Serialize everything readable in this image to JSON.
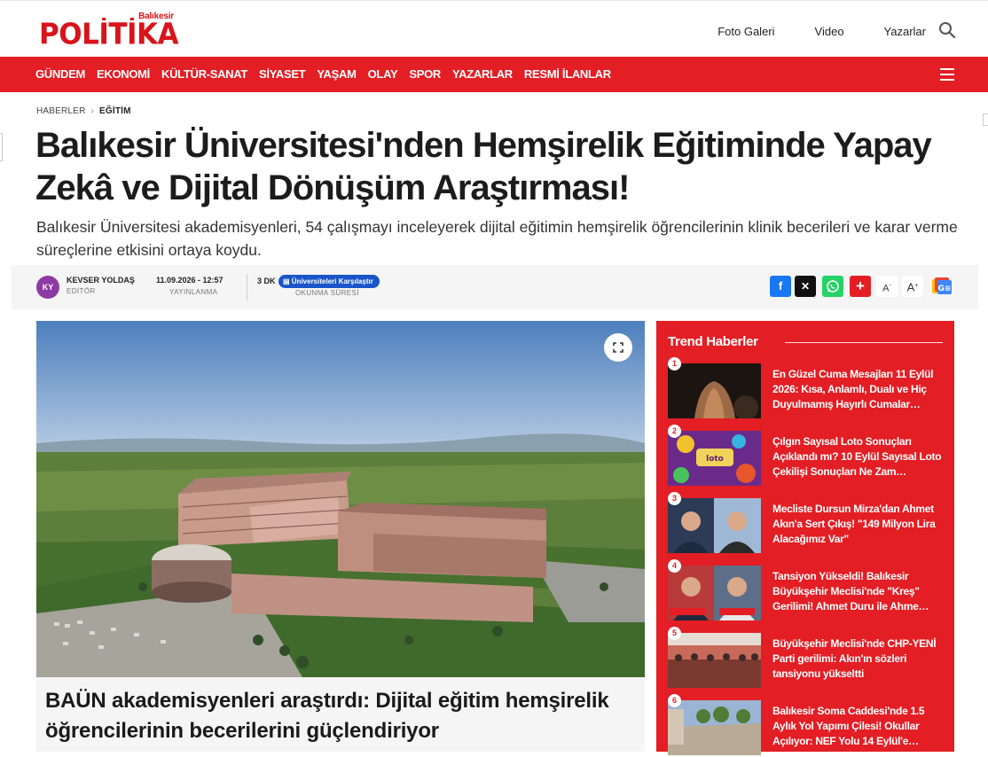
{
  "site": {
    "brand_small": "Balıkesir",
    "brand_big": "POLİTİKA",
    "brand_color": "#d9141b"
  },
  "top_links": [
    "Foto Galeri",
    "Video",
    "Yazarlar"
  ],
  "nav": {
    "items": [
      "GÜNDEM",
      "EKONOMİ",
      "KÜLTÜR-SANAT",
      "SİYASET",
      "YAŞAM",
      "OLAY",
      "SPOR",
      "YAZARLAR",
      "RESMİ İLANLAR"
    ],
    "color": "#e31e24"
  },
  "breadcrumb": {
    "home": "HABERLER",
    "current": "EĞİTİM"
  },
  "article": {
    "headline": "Balıkesir Üniversitesi'nden Hemşirelik Eğitiminde Yapay Zekâ ve Dijital Dönüşüm Araştırması!",
    "summary": "Balıkesir Üniversitesi akademisyenleri, 54 çalışmayı inceleyerek dijital eğitimin hemşirelik öğrencilerinin klinik becerileri ve karar verme süreçlerine etkisini ortaya koydu.",
    "author_initials": "KY",
    "author": "KEVSER YOLDAŞ",
    "author_role": "EDİTÖR",
    "date": "11.09.2026 - 12:57",
    "date_label": "YAYINLANMA",
    "read_time": "3 DK",
    "read_label": "OKUNMA SÜRESİ",
    "compare_label": "Üniversiteleri Karşılaştır",
    "caption": "BAÜN akademisyenleri araştırdı: Dijital eğitim hemşirelik öğrencilerinin becerilerini güçlendiriyor"
  },
  "share": {
    "font_small": "A",
    "font_big": "A",
    "font_small_sup": "-",
    "font_big_sup": "+"
  },
  "trend": {
    "title": "Trend Haberler",
    "items": [
      {
        "num": "1",
        "text": "En Güzel Cuma Mesajları 11 Eylül 2026: Kısa, Anlamlı, Dualı ve Hiç Duyulmamış Hayırlı Cumalar…"
      },
      {
        "num": "2",
        "text": "Çılgın Sayısal Loto Sonuçları Açıklandı mı? 10 Eylül Sayısal Loto Çekilişi Sonuçları Ne Zam…"
      },
      {
        "num": "3",
        "text": "Mecliste Dursun Mirza'dan Ahmet Akın'a Sert Çıkış! \"149 Milyon Lira Alacağımız Var\""
      },
      {
        "num": "4",
        "text": "Tansiyon Yükseldi! Balıkesir Büyükşehir Meclisi'nde \"Kreş\" Gerilimi! Ahmet Duru ile Ahme…"
      },
      {
        "num": "5",
        "text": "Büyükşehir Meclisi'nde CHP-YENİ Parti gerilimi: Akın'ın sözleri tansiyonu yükseltti"
      },
      {
        "num": "6",
        "text": "Balıkesir Soma Caddesi'nde 1.5 Aylık Yol Yapımı Çilesi! Okullar Açılıyor: NEF Yolu 14 Eylül'e…"
      }
    ]
  }
}
